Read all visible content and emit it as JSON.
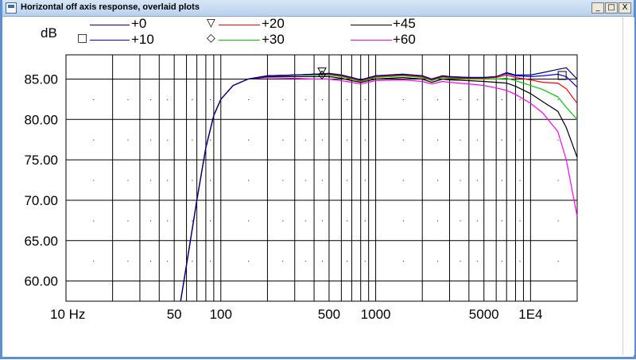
{
  "window": {
    "title": "Horizontal off axis response, overlaid plots",
    "minimize_glyph": "_",
    "maximize_glyph": "□",
    "close_glyph": "X",
    "frame_color": "#5e8fd0"
  },
  "chart_data": {
    "type": "line",
    "ylabel": "dB",
    "x_scale": "log",
    "xlim": [
      10,
      20000
    ],
    "ylim": [
      57.5,
      88
    ],
    "y_ticks": [
      85,
      80,
      75,
      70,
      65,
      60
    ],
    "y_tick_labels": [
      "85.00",
      "80.00",
      "75.00",
      "70.00",
      "65.00",
      "60.00"
    ],
    "x_tick_labels": [
      {
        "value": 10,
        "label": "10 Hz"
      },
      {
        "value": 50,
        "label": "50"
      },
      {
        "value": 100,
        "label": "100"
      },
      {
        "value": 500,
        "label": "500"
      },
      {
        "value": 1000,
        "label": "1000"
      },
      {
        "value": 5000,
        "label": "5000"
      },
      {
        "value": 10000,
        "label": "1E4"
      }
    ],
    "grid": true,
    "legend_placement": "top",
    "series": [
      {
        "name": "+0",
        "color": "#000080",
        "marker": "",
        "points": [
          [
            55,
            57.5
          ],
          [
            60,
            62
          ],
          [
            70,
            70
          ],
          [
            80,
            76.5
          ],
          [
            90,
            80.5
          ],
          [
            100,
            82.5
          ],
          [
            120,
            84.2
          ],
          [
            150,
            85.0
          ],
          [
            200,
            85.4
          ],
          [
            300,
            85.5
          ],
          [
            400,
            85.6
          ],
          [
            500,
            85.7
          ],
          [
            600,
            85.5
          ],
          [
            700,
            85.2
          ],
          [
            800,
            84.9
          ],
          [
            1000,
            85.4
          ],
          [
            1500,
            85.6
          ],
          [
            2000,
            85.4
          ],
          [
            2300,
            85.0
          ],
          [
            2700,
            85.4
          ],
          [
            3000,
            85.3
          ],
          [
            4000,
            85.2
          ],
          [
            5000,
            85.2
          ],
          [
            6000,
            85.3
          ],
          [
            7000,
            85.8
          ],
          [
            8000,
            85.5
          ],
          [
            10000,
            85.5
          ],
          [
            12000,
            85.8
          ],
          [
            15000,
            86.2
          ],
          [
            17000,
            86.4
          ],
          [
            20000,
            85.0
          ]
        ]
      },
      {
        "name": "+10",
        "color": "#0000ff",
        "marker": "□",
        "points": [
          [
            55,
            57.5
          ],
          [
            60,
            62
          ],
          [
            70,
            70
          ],
          [
            80,
            76.5
          ],
          [
            90,
            80.5
          ],
          [
            100,
            82.5
          ],
          [
            120,
            84.2
          ],
          [
            150,
            85.0
          ],
          [
            200,
            85.4
          ],
          [
            300,
            85.5
          ],
          [
            400,
            85.6
          ],
          [
            500,
            85.7
          ],
          [
            600,
            85.5
          ],
          [
            700,
            85.2
          ],
          [
            800,
            84.9
          ],
          [
            1000,
            85.4
          ],
          [
            1500,
            85.6
          ],
          [
            2000,
            85.4
          ],
          [
            2300,
            85.0
          ],
          [
            2700,
            85.4
          ],
          [
            3000,
            85.3
          ],
          [
            4000,
            85.2
          ],
          [
            5000,
            85.2
          ],
          [
            6000,
            85.3
          ],
          [
            7000,
            85.7
          ],
          [
            8000,
            85.4
          ],
          [
            10000,
            85.3
          ],
          [
            12000,
            85.4
          ],
          [
            15000,
            85.6
          ],
          [
            17000,
            85.3
          ],
          [
            20000,
            84.0
          ]
        ]
      },
      {
        "name": "+20",
        "color": "#ff0000",
        "marker": "▽",
        "points": [
          [
            55,
            57.5
          ],
          [
            60,
            62
          ],
          [
            70,
            70
          ],
          [
            80,
            76.5
          ],
          [
            90,
            80.5
          ],
          [
            100,
            82.5
          ],
          [
            120,
            84.2
          ],
          [
            150,
            85.0
          ],
          [
            200,
            85.4
          ],
          [
            300,
            85.5
          ],
          [
            400,
            85.6
          ],
          [
            500,
            85.6
          ],
          [
            600,
            85.4
          ],
          [
            700,
            85.1
          ],
          [
            800,
            84.8
          ],
          [
            1000,
            85.3
          ],
          [
            1500,
            85.5
          ],
          [
            2000,
            85.3
          ],
          [
            2300,
            84.9
          ],
          [
            2700,
            85.3
          ],
          [
            3000,
            85.2
          ],
          [
            4000,
            85.1
          ],
          [
            5000,
            85.1
          ],
          [
            6000,
            85.2
          ],
          [
            7000,
            85.5
          ],
          [
            8000,
            85.2
          ],
          [
            10000,
            84.9
          ],
          [
            12000,
            84.6
          ],
          [
            15000,
            84.5
          ],
          [
            17000,
            83.8
          ],
          [
            20000,
            82.0
          ]
        ]
      },
      {
        "name": "+30",
        "color": "#00cc00",
        "marker": "◇",
        "points": [
          [
            55,
            57.5
          ],
          [
            60,
            62
          ],
          [
            70,
            70
          ],
          [
            80,
            76.5
          ],
          [
            90,
            80.5
          ],
          [
            100,
            82.5
          ],
          [
            120,
            84.2
          ],
          [
            150,
            85.0
          ],
          [
            200,
            85.4
          ],
          [
            300,
            85.5
          ],
          [
            400,
            85.5
          ],
          [
            500,
            85.5
          ],
          [
            600,
            85.3
          ],
          [
            700,
            85.0
          ],
          [
            800,
            84.7
          ],
          [
            1000,
            85.2
          ],
          [
            1500,
            85.4
          ],
          [
            2000,
            85.2
          ],
          [
            2300,
            84.8
          ],
          [
            2700,
            85.2
          ],
          [
            3000,
            85.1
          ],
          [
            4000,
            85.0
          ],
          [
            5000,
            85.0
          ],
          [
            6000,
            85.0
          ],
          [
            7000,
            85.1
          ],
          [
            8000,
            84.8
          ],
          [
            10000,
            84.2
          ],
          [
            12000,
            83.7
          ],
          [
            15000,
            82.8
          ],
          [
            17000,
            81.5
          ],
          [
            20000,
            80.0
          ]
        ]
      },
      {
        "name": "+45",
        "color": "#000000",
        "marker": "",
        "points": [
          [
            55,
            57.5
          ],
          [
            60,
            62
          ],
          [
            70,
            70
          ],
          [
            80,
            76.5
          ],
          [
            90,
            80.5
          ],
          [
            100,
            82.5
          ],
          [
            120,
            84.2
          ],
          [
            150,
            85.0
          ],
          [
            200,
            85.3
          ],
          [
            300,
            85.3
          ],
          [
            400,
            85.3
          ],
          [
            500,
            85.3
          ],
          [
            600,
            85.1
          ],
          [
            700,
            84.8
          ],
          [
            800,
            84.6
          ],
          [
            1000,
            85.0
          ],
          [
            1500,
            85.2
          ],
          [
            2000,
            85.0
          ],
          [
            2300,
            84.6
          ],
          [
            2700,
            85.0
          ],
          [
            3000,
            84.9
          ],
          [
            4000,
            84.8
          ],
          [
            5000,
            84.7
          ],
          [
            6000,
            84.6
          ],
          [
            7000,
            84.5
          ],
          [
            8000,
            84.1
          ],
          [
            10000,
            83.2
          ],
          [
            12000,
            82.2
          ],
          [
            15000,
            81.0
          ],
          [
            17000,
            79.0
          ],
          [
            20000,
            75.3
          ]
        ]
      },
      {
        "name": "+60",
        "color": "#ff00ff",
        "marker": "",
        "points": [
          [
            55,
            57.5
          ],
          [
            60,
            62
          ],
          [
            70,
            70
          ],
          [
            80,
            76.5
          ],
          [
            90,
            80.5
          ],
          [
            100,
            82.5
          ],
          [
            120,
            84.2
          ],
          [
            150,
            85.0
          ],
          [
            200,
            85.2
          ],
          [
            300,
            85.1
          ],
          [
            400,
            85.0
          ],
          [
            500,
            85.0
          ],
          [
            600,
            84.8
          ],
          [
            700,
            84.6
          ],
          [
            800,
            84.4
          ],
          [
            1000,
            84.8
          ],
          [
            1500,
            84.9
          ],
          [
            2000,
            84.7
          ],
          [
            2300,
            84.4
          ],
          [
            2700,
            84.7
          ],
          [
            3000,
            84.6
          ],
          [
            4000,
            84.4
          ],
          [
            5000,
            84.2
          ],
          [
            6000,
            83.9
          ],
          [
            7000,
            83.6
          ],
          [
            8000,
            83.1
          ],
          [
            10000,
            82.0
          ],
          [
            12000,
            80.8
          ],
          [
            15000,
            78.5
          ],
          [
            17000,
            75.0
          ],
          [
            20000,
            68.0
          ]
        ]
      }
    ]
  }
}
